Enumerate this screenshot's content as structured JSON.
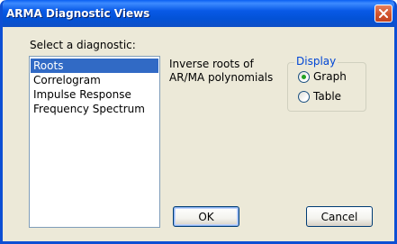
{
  "window": {
    "title": "ARMA Diagnostic Views"
  },
  "diagnostic": {
    "label": "Select a diagnostic:",
    "items": [
      {
        "label": "Roots",
        "selected": true
      },
      {
        "label": "Correlogram",
        "selected": false
      },
      {
        "label": "Impulse Response",
        "selected": false
      },
      {
        "label": "Frequency Spectrum",
        "selected": false
      }
    ],
    "description_line1": "Inverse roots of",
    "description_line2": "AR/MA polynomials"
  },
  "display": {
    "legend": "Display",
    "options": [
      {
        "label": "Graph",
        "checked": true
      },
      {
        "label": "Table",
        "checked": false
      }
    ]
  },
  "buttons": {
    "ok_label": "OK",
    "cancel_label": "Cancel"
  },
  "colors": {
    "title_bar": "#0a5ff2",
    "selection": "#316ac5",
    "group_legend": "#0046d5",
    "radio_dot": "#21a121",
    "dialog_bg": "#ece9d8"
  }
}
